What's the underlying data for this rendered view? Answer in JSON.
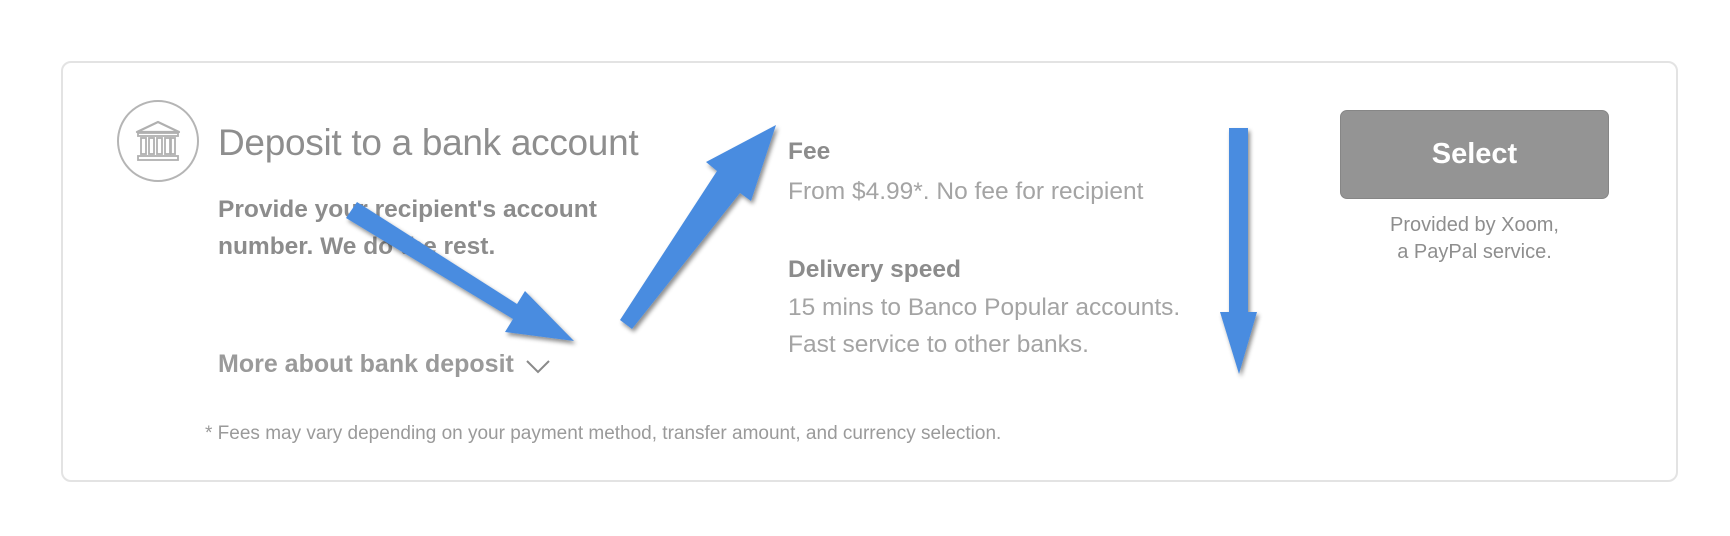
{
  "option": {
    "icon": "bank-icon",
    "title": "Deposit to a bank account",
    "subtitle": "Provide your recipient's account number. We do the rest.",
    "more_link_label": "More about bank deposit",
    "more_link_icon": "chevron-down-icon",
    "footnote": "* Fees may vary depending on your payment method, transfer amount, and currency selection."
  },
  "fee": {
    "heading": "Fee",
    "text": "From $4.99*. No fee for recipient"
  },
  "delivery": {
    "heading": "Delivery speed",
    "line1": "15 mins to Banco Popular accounts.",
    "line2": "Fast service to other banks."
  },
  "action": {
    "select_label": "Select",
    "provided_line1": "Provided by Xoom,",
    "provided_line2": "a PayPal service."
  },
  "annotations": {
    "arrow_color": "#4a8ce0",
    "arrow_icons": [
      "arrow-down-right-icon",
      "arrow-up-right-icon",
      "arrow-down-icon"
    ]
  }
}
